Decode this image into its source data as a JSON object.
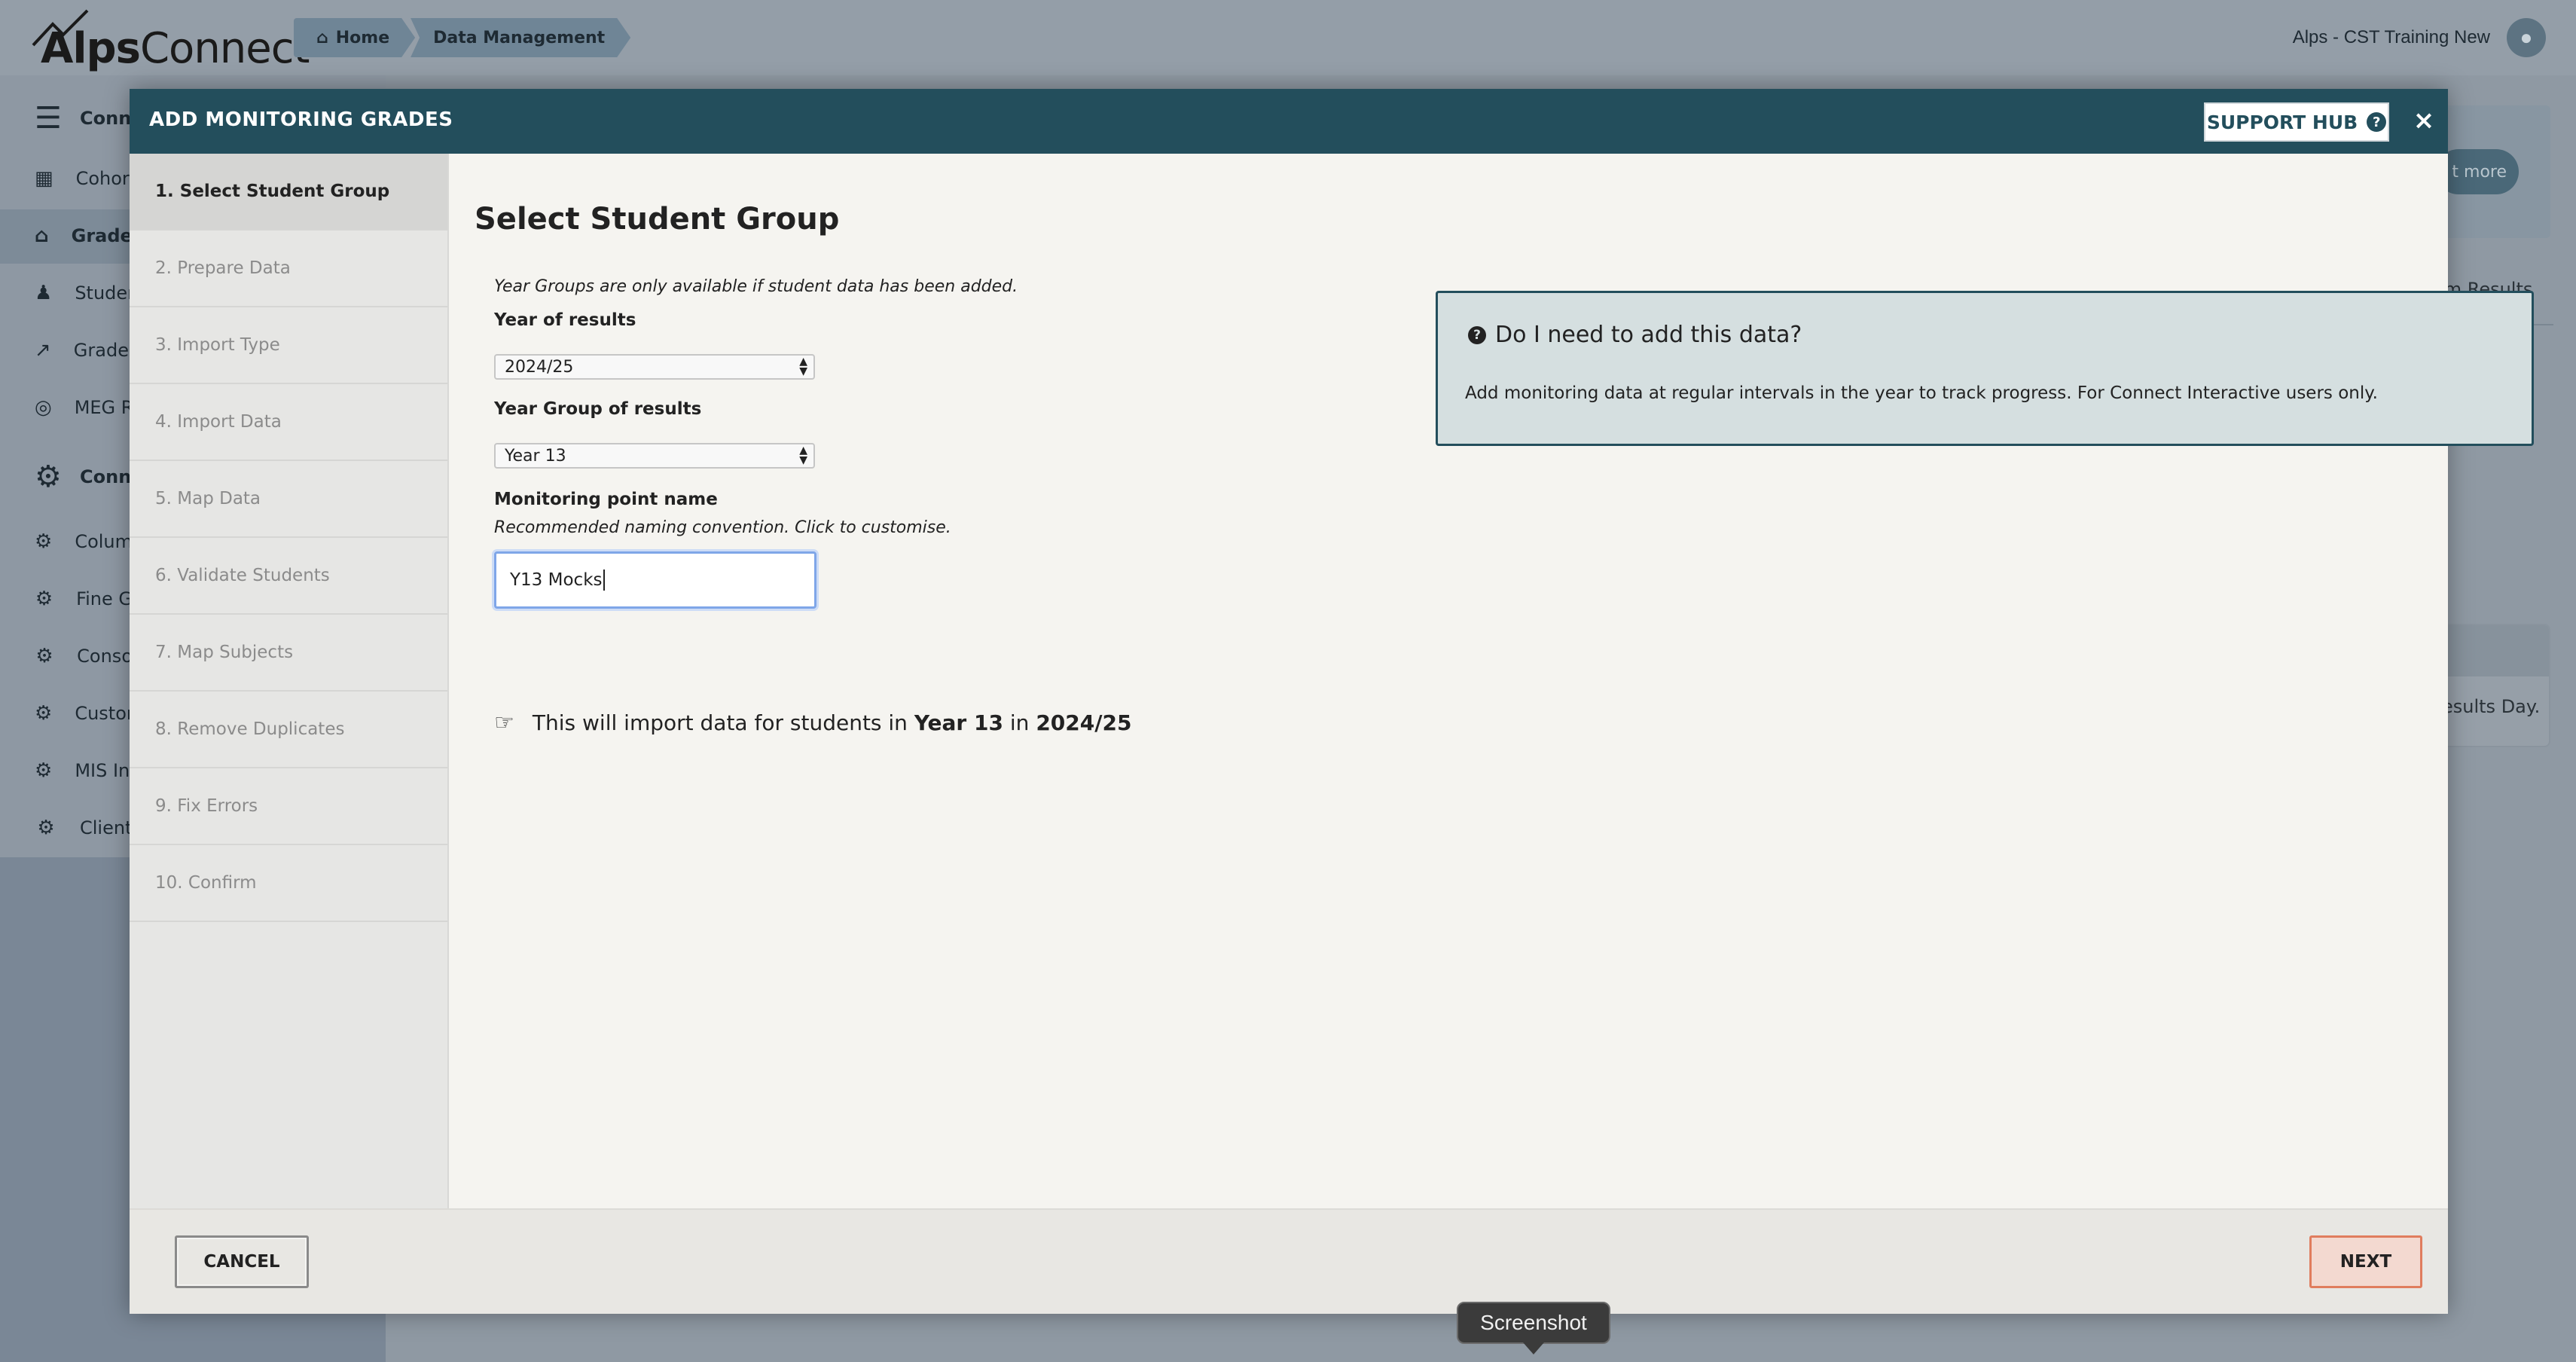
{
  "app": {
    "logo_alps": "Alps",
    "logo_connect": "Connect",
    "breadcrumbs": [
      "Home",
      "Data Management"
    ],
    "user_name": "Alps - CST Training New"
  },
  "sidebar": {
    "sections": [
      {
        "label": "Conne",
        "icon": "database-icon"
      },
      {
        "label": "Conne",
        "icon": "gear-icon"
      }
    ],
    "items": [
      {
        "label": "Cohort",
        "icon": "table-icon"
      },
      {
        "label": "Grades",
        "icon": "graduation-cap-icon"
      },
      {
        "label": "Studen",
        "icon": "student-icon"
      },
      {
        "label": "Grades",
        "icon": "line-chart-icon"
      },
      {
        "label": "MEG R",
        "icon": "target-icon"
      },
      {
        "label": "Colum",
        "icon": "gear-icon"
      },
      {
        "label": "Fine G",
        "icon": "gear-icon"
      },
      {
        "label": "Conso",
        "icon": "gear-icon"
      },
      {
        "label": "Custor",
        "icon": "gear-icon"
      },
      {
        "label": "MIS Int",
        "icon": "gear-icon"
      },
      {
        "label": "Client",
        "icon": "gear-icon"
      }
    ]
  },
  "background": {
    "learn_more": "t more",
    "exam_tab": "am Results",
    "results_text": "esults Day."
  },
  "modal": {
    "title": "ADD MONITORING GRADES",
    "support_hub": "SUPPORT HUB",
    "close_glyph": "×",
    "steps": [
      "1. Select Student Group",
      "2. Prepare Data",
      "3. Import Type",
      "4. Import Data",
      "5. Map Data",
      "6. Validate Students",
      "7. Map Subjects",
      "8. Remove Duplicates",
      "9. Fix Errors",
      "10. Confirm"
    ],
    "active_step": 0,
    "page_title": "Select Student Group",
    "hint": "Year Groups are only available if student data has been added.",
    "year_label": "Year of results",
    "year_value": "2024/25",
    "group_label": "Year Group of results",
    "group_value": "Year 13",
    "monitoring_label": "Monitoring point name",
    "monitoring_hint": "Recommended naming convention. Click to customise.",
    "monitoring_value": "Y13 Mocks",
    "import_note": {
      "prefix": "This will import data for students in",
      "group": "Year 13",
      "mid": "in",
      "year": "2024/25"
    },
    "info": {
      "title": "Do I need to add this data?",
      "body": "Add monitoring data at regular intervals in the year to track progress. For Connect Interactive users only."
    },
    "cancel_label": "CANCEL",
    "next_label": "NEXT"
  },
  "tooltip": "Screenshot",
  "colors": {
    "header": "#234e5c",
    "next_border": "#e07d5e",
    "next_fill": "#f3d9d0",
    "info_fill": "#d5dfe0"
  }
}
